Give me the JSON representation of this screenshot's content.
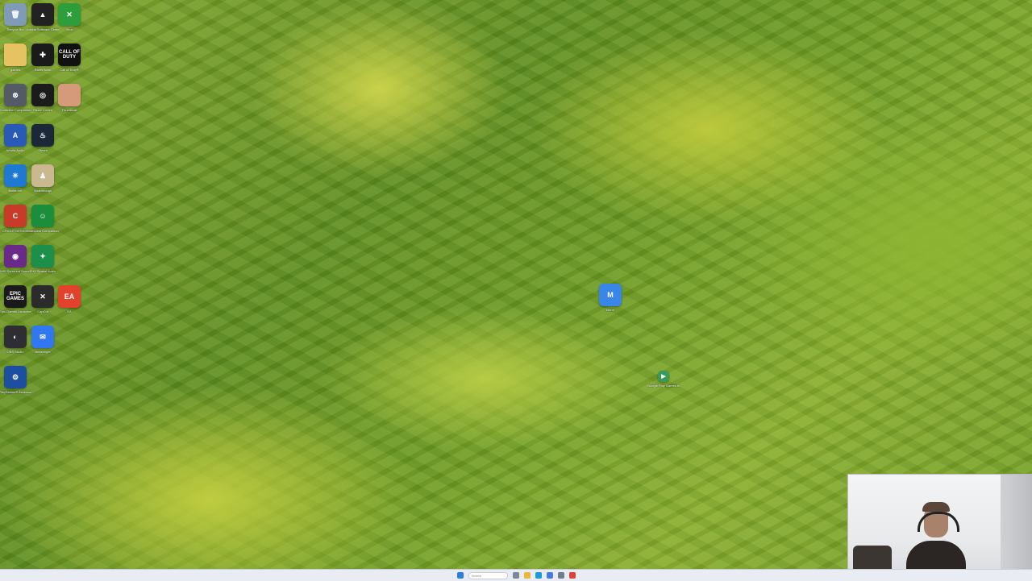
{
  "desktop": {
    "icons": [
      {
        "name": "recycle-bin-icon",
        "label": "Recycle Bin",
        "glyph": "🗑",
        "color": "#7f9bb8"
      },
      {
        "name": "arturia-icon",
        "label": "Arturia Software Center",
        "glyph": "▲",
        "color": "#222222"
      },
      {
        "name": "xbox-icon",
        "label": "Xbox",
        "glyph": "✕",
        "color": "#2e9e3a"
      },
      {
        "name": "folder-icon",
        "label": "games",
        "glyph": "",
        "color": "#e7c262"
      },
      {
        "name": "razer-icon",
        "label": "Razer Axon",
        "glyph": "✚",
        "color": "#1a1a1a"
      },
      {
        "name": "call-of-duty-icon",
        "label": "Call of Duty®",
        "glyph": "CALL OF DUTY",
        "color": "#111111"
      },
      {
        "name": "controller-companion-icon",
        "label": "Controller Companion",
        "glyph": "⊗",
        "color": "#555b66"
      },
      {
        "name": "razer-cortex-icon",
        "label": "Razer Cortex",
        "glyph": "◎",
        "color": "#1b1b1b"
      },
      {
        "name": "game-thumbnail-icon",
        "label": "Thumbnail",
        "glyph": "",
        "color": "#d49a7a"
      },
      {
        "name": "arturia-app-icon",
        "label": "Arturia Audio",
        "glyph": "A",
        "color": "#2a5ab8"
      },
      {
        "name": "steam-icon",
        "label": "Steam",
        "glyph": "♨",
        "color": "#1b2838"
      },
      {
        "name": "battlenet-icon",
        "label": "Battle.net",
        "glyph": "✳",
        "color": "#1f78d1"
      },
      {
        "name": "figure-app-icon",
        "label": "Walkthrough",
        "glyph": "♟",
        "color": "#c9b890"
      },
      {
        "name": "cricut-icon",
        "label": "CRICUT DESIGN",
        "glyph": "C",
        "color": "#c83a2a"
      },
      {
        "name": "smile-app-icon",
        "label": "Sidequest Companion",
        "glyph": "☺",
        "color": "#1a8e3a"
      },
      {
        "name": "nahimic-icon",
        "label": "MSI Surround Sound",
        "glyph": "◉",
        "color": "#6a2a8a"
      },
      {
        "name": "thx-icon",
        "label": "THX Spatial Audio",
        "glyph": "✦",
        "color": "#1c8f4a"
      },
      {
        "name": "epic-games-icon",
        "label": "Epic Games Launcher",
        "glyph": "EPIC GAMES",
        "color": "#1a1a1a"
      },
      {
        "name": "capcut-icon",
        "label": "CapCut",
        "glyph": "✕",
        "color": "#2b2b2b"
      },
      {
        "name": "ea-icon",
        "label": "EA",
        "glyph": "EA",
        "color": "#e4412c"
      },
      {
        "name": "obs-icon",
        "label": "OBS Studio",
        "glyph": "◐",
        "color": "#2d2d33"
      },
      {
        "name": "messenger-icon",
        "label": "Messenger",
        "glyph": "✉",
        "color": "#3178f0"
      },
      {
        "name": "playstation-icon",
        "label": "PlayStation® Accessories",
        "glyph": "⚙",
        "color": "#1d4fa0"
      },
      {
        "name": "mirror-app-icon",
        "label": "Mirror",
        "glyph": "M",
        "color": "#3a86e8"
      },
      {
        "name": "google-play-icon",
        "label": "Google Play Games beta",
        "glyph": "▶",
        "color": "#3a9a5a"
      }
    ]
  },
  "taskbar": {
    "left_text": "",
    "search_placeholder": "Search",
    "items": [
      {
        "name": "start-icon",
        "color": "#2f7de1"
      },
      {
        "name": "task-view-icon",
        "color": "#7a8796"
      },
      {
        "name": "file-explorer-icon",
        "color": "#e8b93a"
      },
      {
        "name": "edge-icon",
        "color": "#1a9ad6"
      },
      {
        "name": "store-icon",
        "color": "#4a7bd6"
      },
      {
        "name": "settings-icon",
        "color": "#6e7d90"
      },
      {
        "name": "chrome-icon",
        "color": "#db4437"
      }
    ]
  }
}
